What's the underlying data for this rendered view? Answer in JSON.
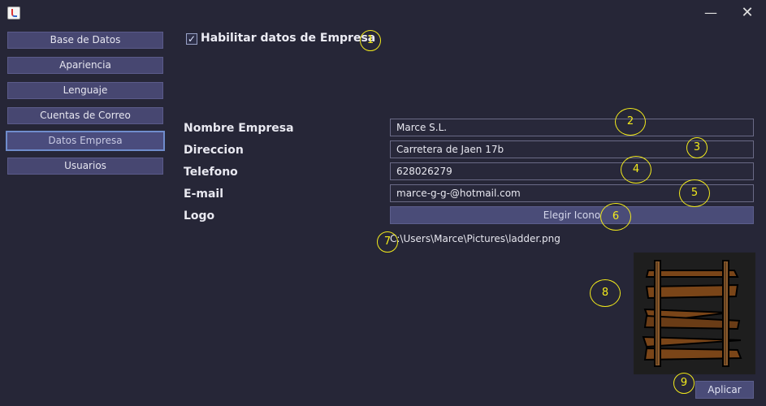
{
  "window": {
    "app_icon": "java-cup-icon",
    "minimize_glyph": "—",
    "close_glyph": "✕"
  },
  "sidebar": {
    "items": [
      {
        "label": "Base de Datos",
        "active": false
      },
      {
        "label": "Apariencia",
        "active": false
      },
      {
        "label": "Lenguaje",
        "active": false
      },
      {
        "label": "Cuentas de Correo",
        "active": false
      },
      {
        "label": "Datos Empresa",
        "active": true
      },
      {
        "label": "Usuarios",
        "active": false
      }
    ]
  },
  "form": {
    "enable_checkbox": {
      "label": "Habilitar datos de Empresa",
      "checked": true,
      "glyph": "✓"
    },
    "fields": {
      "company_name": {
        "label": "Nombre Empresa",
        "value": "Marce S.L."
      },
      "address": {
        "label": "Direccion",
        "value": "Carretera de Jaen 17b"
      },
      "phone": {
        "label": "Telefono",
        "value": "628026279"
      },
      "email": {
        "label": "E-mail",
        "value": "marce-g-g-@hotmail.com"
      }
    },
    "logo": {
      "label": "Logo",
      "choose_button": "Elegir Icono",
      "path": "C:\\Users\\Marce\\Pictures\\ladder.png",
      "preview": "ladder-image"
    },
    "apply_button": "Aplicar"
  },
  "annotations": [
    "1",
    "2",
    "3",
    "4",
    "5",
    "6",
    "7",
    "8",
    "9"
  ],
  "colors": {
    "background": "#262637",
    "button": "#474771",
    "active_border": "#6f8ccc",
    "marker": "#f2ea1c"
  }
}
